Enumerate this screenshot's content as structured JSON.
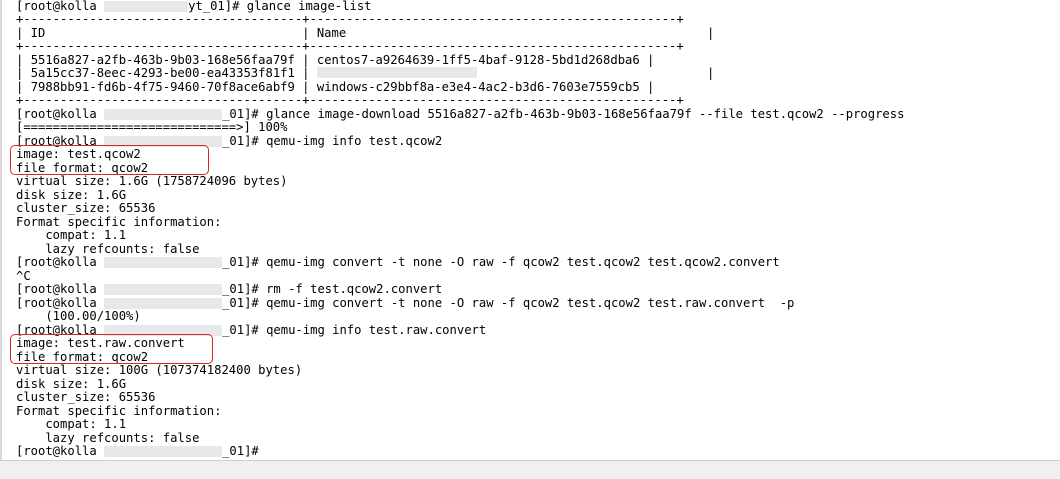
{
  "colors": {
    "highlight": "#d8262b",
    "redaction": "#e6e8ea"
  },
  "terminal": {
    "prompt_user": "[root@kolla",
    "cmd_image_list_suffix": "yt_01]# glance image-list",
    "table": {
      "border_top": "+--------------------------------------+--------------------------------------------------+",
      "header_line_left": "| ID                                   | Name",
      "header_line_right": "|",
      "border_mid": "+--------------------------------------+--------------------------------------------------+",
      "rows": [
        {
          "id": "5516a827-a2fb-463b-9b03-168e56faa79f",
          "name": "centos7-a9264639-1ff5-4baf-9128-5bd1d268dba6"
        },
        {
          "id": "5a15cc37-8eec-4293-be00-ea43353f81f1",
          "name": ""
        },
        {
          "id": "7988bb91-fd6b-4f75-9460-70f8ace6abf9",
          "name": "windows-c29bbf8a-e3e4-4ac2-b3d6-7603e7559cb5"
        }
      ],
      "border_bottom": "+--------------------------------------+--------------------------------------------------+"
    },
    "cmd_download_suffix": "_01]# glance image-download 5516a827-a2fb-463b-9b03-168e56faa79f --file test.qcow2 --progress",
    "progress_bar": "[=============================>] 100%",
    "cmd_info1_suffix": "_01]# qemu-img info test.qcow2",
    "info1": {
      "image": "image: test.qcow2",
      "format": "file format: qcow2",
      "virtual": "virtual size: 1.6G (1758724096 bytes)",
      "disk": "disk size: 1.6G",
      "cluster": "cluster_size: 65536",
      "fsi": "Format specific information:",
      "compat": "    compat: 1.1",
      "lazy": "    lazy refcounts: false"
    },
    "cmd_convert1_suffix": "_01]# qemu-img convert -t none -O raw -f qcow2 test.qcow2 test.qcow2.convert",
    "ctrl_c": "^C",
    "cmd_rm_suffix": "_01]# rm -f test.qcow2.convert",
    "cmd_convert2_suffix": "_01]# qemu-img convert -t none -O raw -f qcow2 test.qcow2 test.raw.convert  -p",
    "convert_progress": "    (100.00/100%)",
    "cmd_info2_suffix": "_01]# qemu-img info test.raw.convert",
    "info2": {
      "image": "image: test.raw.convert",
      "format": "file format: qcow2",
      "virtual": "virtual size: 100G (107374182400 bytes)",
      "disk": "disk size: 1.6G",
      "cluster": "cluster_size: 65536",
      "fsi": "Format specific information:",
      "compat": "    compat: 1.1",
      "lazy": "    lazy refcounts: false"
    },
    "final_prompt_suffix": "_01]#"
  }
}
